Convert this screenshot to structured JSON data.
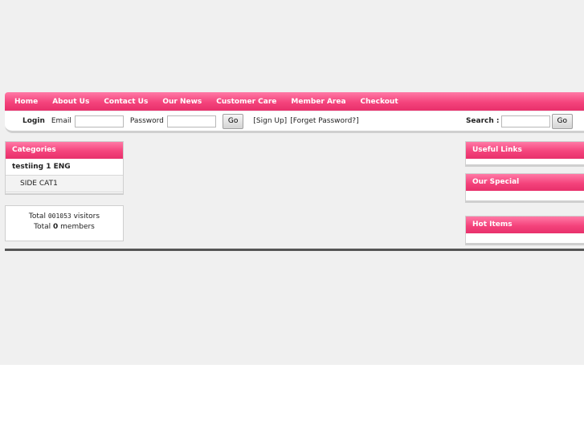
{
  "nav": {
    "items": [
      "Home",
      "About Us",
      "Contact Us",
      "Our News",
      "Customer Care",
      "Member Area",
      "Checkout"
    ]
  },
  "login": {
    "label": "Login",
    "email_label": "Email",
    "password_label": "Password",
    "go_label": "Go",
    "signup_link": "[Sign Up]",
    "forget_link": "[Forget Password?]",
    "search_label": "Search :",
    "search_go_label": "Go"
  },
  "categories": {
    "title": "Categories",
    "main": "testiing 1 ENG",
    "sub": "SIDE CAT1"
  },
  "stats": {
    "total_prefix": "Total",
    "visitors_count": "001053",
    "visitors_suffix": "visitors",
    "members_count": "0",
    "members_suffix": "members"
  },
  "sidebar": {
    "useful_links": "Useful Links",
    "our_special": "Our Special",
    "hot_items": "Hot Items"
  },
  "colors": {
    "accent": "#f4437c",
    "footer_line": "#555555"
  }
}
